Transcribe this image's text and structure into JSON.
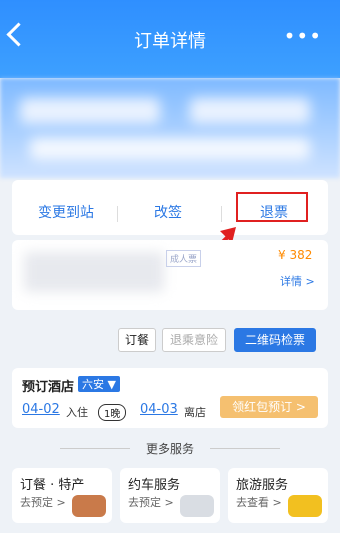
{
  "header": {
    "title": "订单详情",
    "back_icon": "chevron-left-icon",
    "more_icon": "more-icon"
  },
  "actions": {
    "change_destination": "变更到站",
    "rebook": "改签",
    "refund": "退票"
  },
  "ticket": {
    "price": "¥ 382",
    "detail": "详情 >",
    "tag": "成人票"
  },
  "buttons": {
    "meal": "订餐",
    "insurance": "退乘意险",
    "qr": "二维码检票"
  },
  "hotel": {
    "title": "预订酒店",
    "city": "六安 ▼",
    "checkin_date": "04-02",
    "checkin_label": "入住",
    "nights": "1晚",
    "checkout_date": "04-03",
    "checkout_label": "离店",
    "coupon": "领红包预订 >"
  },
  "more_services": {
    "title": "更多服务"
  },
  "services": [
    {
      "title": "订餐 · 特产",
      "sub": "去预定 >"
    },
    {
      "title": "约车服务",
      "sub": "去预定 >"
    },
    {
      "title": "旅游服务",
      "sub": "去查看 >"
    }
  ],
  "colors": {
    "accent": "#2b78e4",
    "highlight": "#e02020",
    "price": "#ff8a00"
  }
}
